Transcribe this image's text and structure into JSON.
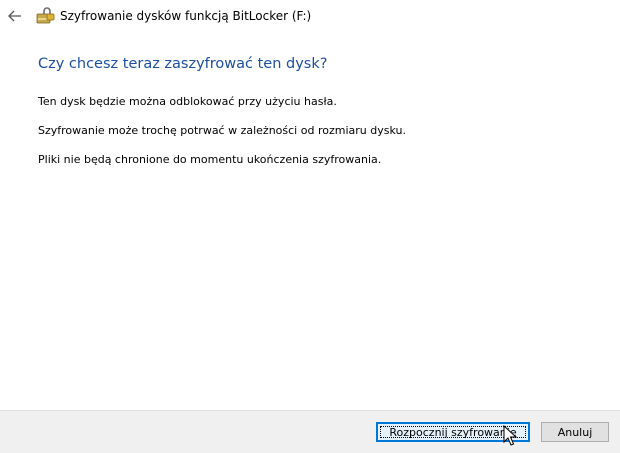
{
  "window": {
    "title": "Szyfrowanie dysków funkcją BitLocker (F:)",
    "back_icon": "back-arrow-icon",
    "app_icon": "bitlocker-drive-icon"
  },
  "main": {
    "heading": "Czy chcesz teraz zaszyfrować ten dysk?",
    "paragraphs": [
      "Ten dysk będzie można odblokować przy użyciu hasła.",
      "Szyfrowanie może trochę potrwać w zależności od rozmiaru dysku.",
      "Pliki nie będą chronione do momentu ukończenia szyfrowania."
    ]
  },
  "footer": {
    "start_label": "Rozpocznij szyfrowanie",
    "cancel_label": "Anuluj"
  },
  "colors": {
    "heading": "#1e4fa0",
    "footer_bg": "#f0f0f0",
    "primary_border": "#0078d7",
    "primary_bg": "#e5f1fb"
  }
}
